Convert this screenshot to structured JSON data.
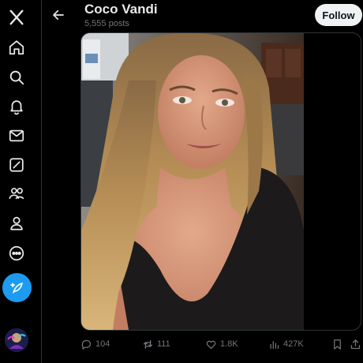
{
  "header": {
    "name": "Coco Vandi",
    "post_count": "5,555 posts",
    "follow_label": "Follow"
  },
  "sidebar": {
    "icons": [
      "x-logo-icon",
      "home-icon",
      "search-icon",
      "notifications-icon",
      "messages-icon",
      "grok-icon",
      "communities-icon",
      "profile-icon",
      "more-icon"
    ],
    "compose_icon": "compose-post-icon"
  },
  "post": {
    "media_alt": "photo",
    "actions": {
      "replies": "104",
      "reposts": "111",
      "likes": "1.8K",
      "views": "427K"
    }
  },
  "colors": {
    "background": "#000000",
    "accent": "#1d9bf0",
    "muted_text": "#71767b",
    "primary_text": "#e7e9ea",
    "follow_bg": "#eff3f4"
  }
}
